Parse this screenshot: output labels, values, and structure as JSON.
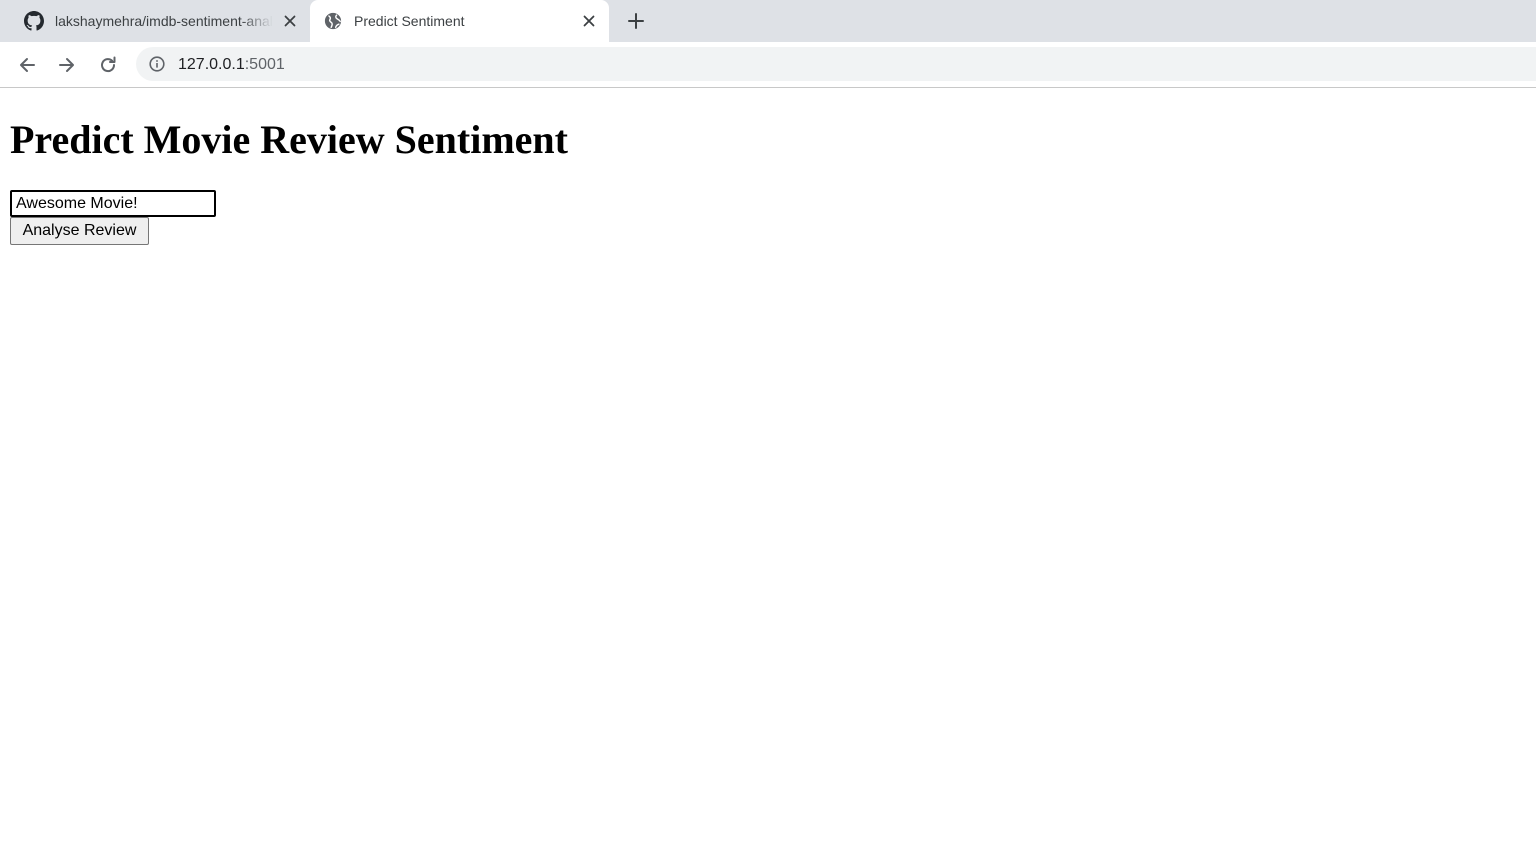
{
  "browser": {
    "tabs": [
      {
        "title": "lakshaymehra/imdb-sentiment-analysis",
        "favicon": "github-icon",
        "active": false
      },
      {
        "title": "Predict Sentiment",
        "favicon": "globe-icon",
        "active": true
      }
    ],
    "address_bar": {
      "host": "127.0.0.1",
      "port": ":5001",
      "icon": "info-icon"
    }
  },
  "page": {
    "heading": "Predict Movie Review Sentiment",
    "review_input": {
      "value": "Awesome Movie!",
      "placeholder": ""
    },
    "submit_label": "Analyse Review"
  },
  "colors": {
    "tab_strip_bg": "#dee1e6",
    "omnibox_bg": "#f1f3f4",
    "icon_color": "#5f6368",
    "button_bg": "#efefef"
  }
}
